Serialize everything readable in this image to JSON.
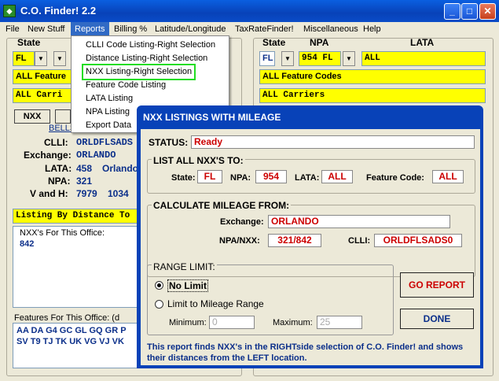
{
  "window": {
    "title": "C.O. Finder! 2.2"
  },
  "menu": [
    "File",
    "New Stuff",
    "Reports",
    "Billing %",
    "Latitude/Longitude",
    "TaxRateFinder!",
    "Miscellaneous",
    "Help"
  ],
  "reports_menu": [
    "CLLI Code Listing-Right Selection",
    "Distance Listing-Right Selection",
    "NXX Listing-Right Selection",
    "Feature Code Listing",
    "LATA Listing",
    "NPA Listing",
    "Export Data"
  ],
  "left": {
    "state_label": "State",
    "state_value": "FL",
    "feature_value": "ALL Feature",
    "carrier_value": "ALL Carri",
    "nxx_button": "NXX",
    "bells": "BELLS",
    "clli_label": "CLLI:",
    "clli_value": "ORLDFLSADS",
    "exchange_label": "Exchange:",
    "exchange_value": "ORLANDO",
    "lata_label": "LATA:",
    "lata_value": "458",
    "lata_name": "Orlando",
    "npa_label": "NPA:",
    "npa_value": "321",
    "vh_label": "V and H:",
    "v_value": "7979",
    "h_value": "1034",
    "listing_by": "Listing By Distance To",
    "nxx_for_office": "NXX's For This Office:",
    "nxx_list": "842",
    "features_label": "Features For This Office: (d",
    "features_line1": "AA DA G4 GC GL GQ GR P",
    "features_line2": "SV T9 TJ TK UK VG VJ VK"
  },
  "right": {
    "state_label": "State",
    "npa_label": "NPA",
    "lata_label": "LATA",
    "state_value": "FL",
    "npa_value": "954 FL",
    "lata_value": "ALL",
    "feature_value": "ALL Feature Codes",
    "carrier_value": "ALL Carriers"
  },
  "dialog": {
    "title": "NXX LISTINGS WITH MILEAGE",
    "status_label": "STATUS:",
    "status_value": "Ready",
    "list_header": "LIST ALL NXX'S TO:",
    "state_label": "State:",
    "state_value": "FL",
    "npa_label": "NPA:",
    "npa_value": "954",
    "lata_label": "LATA:",
    "lata_value": "ALL",
    "feature_label": "Feature Code:",
    "feature_value": "ALL",
    "calc_header": "CALCULATE MILEAGE FROM:",
    "exchange_label": "Exchange:",
    "exchange_value": "ORLANDO",
    "npanxx_label": "NPA/NXX:",
    "npanxx_value": "321/842",
    "clli_label": "CLLI:",
    "clli_value": "ORLDFLSADS0",
    "range_header": "RANGE LIMIT:",
    "no_limit": "No Limit",
    "limit_range": "Limit to Mileage Range",
    "min_label": "Minimum:",
    "min_value": "0",
    "max_label": "Maximum:",
    "max_value": "25",
    "go_button": "GO REPORT",
    "done_button": "DONE",
    "footer": "This report finds NXX's in the RIGHTside selection of C.O. Finder! and shows their distances from the LEFT location."
  }
}
